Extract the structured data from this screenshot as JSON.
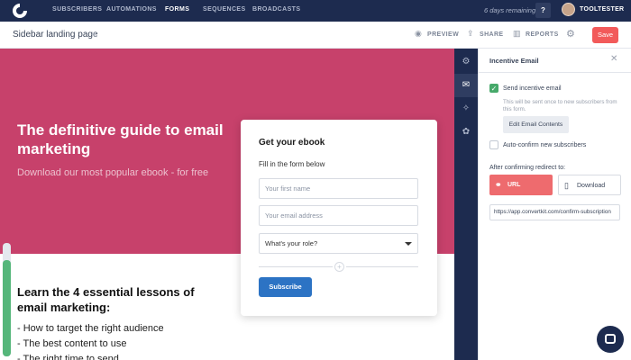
{
  "nav": {
    "items": [
      "SUBSCRIBERS",
      "AUTOMATIONS",
      "FORMS",
      "SEQUENCES",
      "BROADCASTS"
    ],
    "active": "FORMS",
    "trial": "6 days remaining",
    "help": "?",
    "user": "TOOLTESTER"
  },
  "header": {
    "title": "Sidebar landing page",
    "preview": "PREVIEW",
    "share": "SHARE",
    "reports": "REPORTS",
    "save": "Save"
  },
  "page": {
    "hero_title": "The definitive guide to email marketing",
    "hero_sub": "Download our most popular ebook - for free",
    "lessons_title": "Learn the 4 essential lessons of email marketing:",
    "bullets": [
      "- How to target the right audience",
      "- The best content to use",
      "- The right time to send"
    ],
    "scroll_progress": 0.85
  },
  "form": {
    "title": "Get your ebook",
    "subtitle": "Fill in the form below",
    "first_name_placeholder": "Your first name",
    "email_placeholder": "Your email address",
    "role_value": "What's your role?",
    "subscribe": "Subscribe"
  },
  "panel": {
    "title": "Incentive Email",
    "send_incentive": "Send incentive email",
    "send_hint": "This will be sent once to new subscribers from this form.",
    "edit_btn": "Edit Email Contents",
    "auto_confirm": "Auto-confirm new subscribers",
    "redirect_label": "After confirming redirect to:",
    "url_option": "URL",
    "download_option": "Download",
    "url_value": "https://app.convertkit.com/confirm-subscription"
  },
  "colors": {
    "navy": "#1d2b4f",
    "hero": "#c7416b",
    "save": "#f25a5a",
    "subscribe": "#2c73c4",
    "check": "#46a96a",
    "url_btn": "#ee6b6e"
  }
}
